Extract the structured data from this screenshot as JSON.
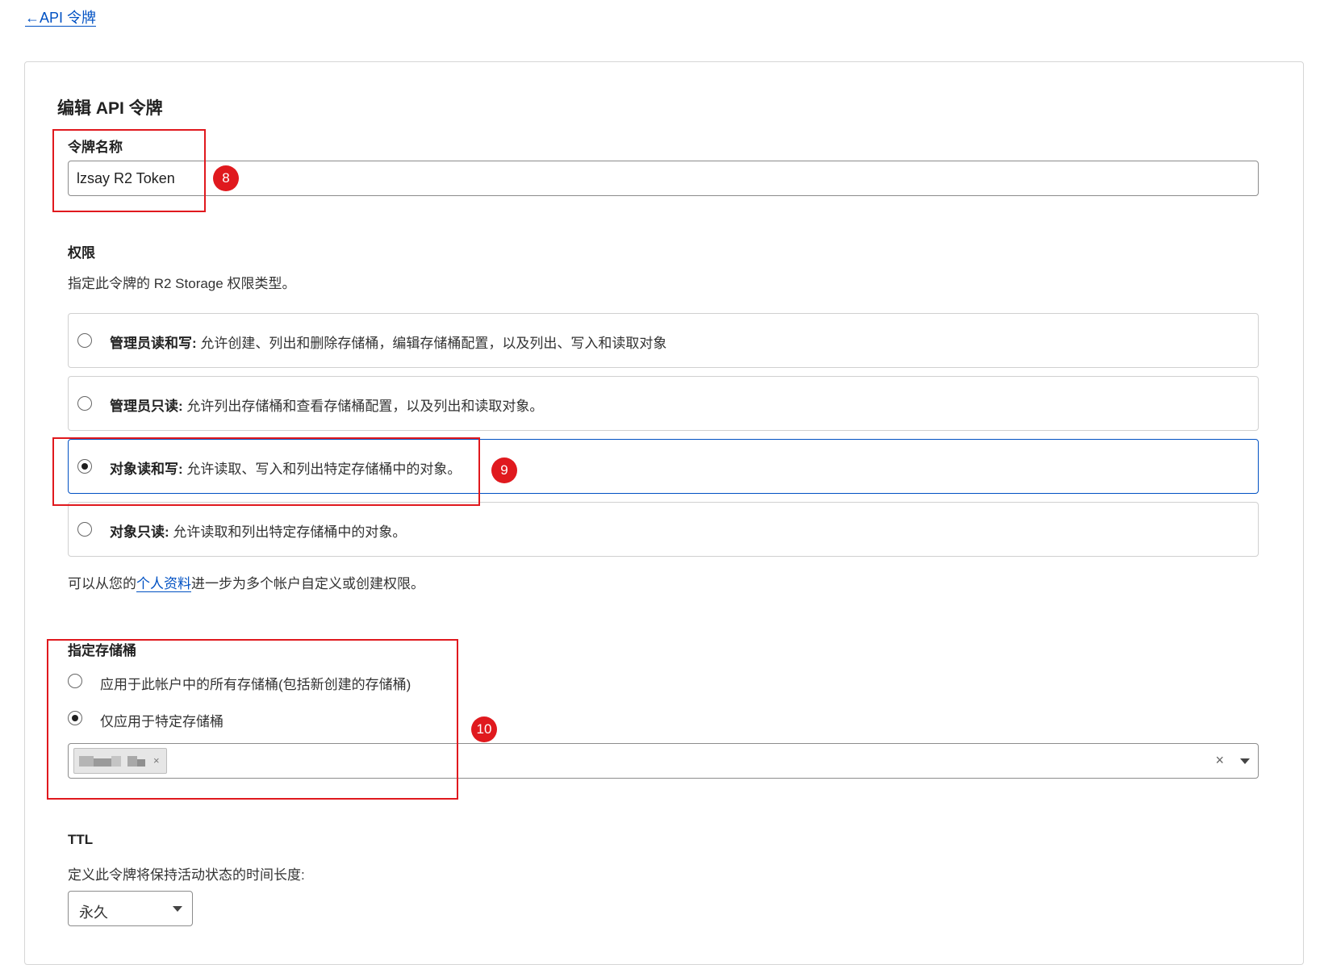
{
  "nav": {
    "back_link": "←API 令牌"
  },
  "form": {
    "title": "编辑 API 令牌",
    "token_name": {
      "label": "令牌名称",
      "value": "lzsay R2 Token"
    },
    "permissions": {
      "label": "权限",
      "description": "指定此令牌的 R2 Storage 权限类型。",
      "options": [
        {
          "title": "管理员读和写:",
          "desc": "允许创建、列出和删除存储桶，编辑存储桶配置，以及列出、写入和读取对象",
          "selected": false
        },
        {
          "title": "管理员只读:",
          "desc": "允许列出存储桶和查看存储桶配置，以及列出和读取对象。",
          "selected": false
        },
        {
          "title": "对象读和写:",
          "desc": "允许读取、写入和列出特定存储桶中的对象。",
          "selected": true
        },
        {
          "title": "对象只读:",
          "desc": "允许读取和列出特定存储桶中的对象。",
          "selected": false
        }
      ],
      "footer_before": "可以从您的",
      "footer_link": "个人资料",
      "footer_after": "进一步为多个帐户自定义或创建权限。"
    },
    "buckets": {
      "label": "指定存储桶",
      "options": [
        {
          "label": "应用于此帐户中的所有存储桶(包括新创建的存储桶)",
          "selected": false
        },
        {
          "label": "仅应用于特定存储桶",
          "selected": true
        }
      ],
      "remove_symbol": "×",
      "clear_symbol": "×"
    },
    "ttl": {
      "label": "TTL",
      "description": "定义此令牌将保持活动状态的时间长度:",
      "value": "永久"
    }
  },
  "annotations": [
    "8",
    "9",
    "10"
  ],
  "colors": {
    "link": "#0051c3",
    "annotation": "#e0191e",
    "selected_border": "#0051c3"
  }
}
